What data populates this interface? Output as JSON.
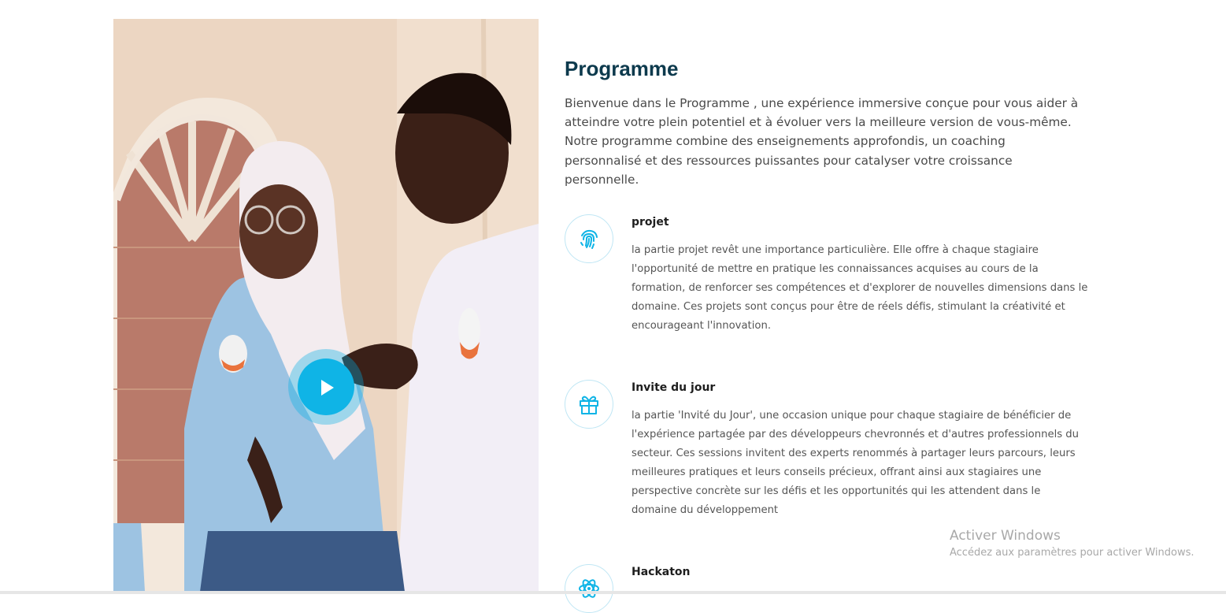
{
  "video": {
    "play_icon": "play-icon",
    "colors": {
      "play": "#0fb4e6"
    }
  },
  "programme": {
    "title": "Programme",
    "intro": "Bienvenue dans le Programme , une expérience immersive conçue pour vous aider à atteindre votre plein potentiel et à évoluer vers la meilleure version de vous-même. Notre programme combine des enseignements approfondis, un coaching personnalisé et des ressources puissantes pour catalyser votre croissance personnelle."
  },
  "features": [
    {
      "icon": "fingerprint-icon",
      "title": "projet",
      "text": "la partie projet revêt une importance particulière. Elle offre à chaque stagiaire l'opportunité de mettre en pratique les connaissances acquises au cours de la formation, de renforcer ses compétences et d'explorer de nouvelles dimensions dans le domaine. Ces projets sont conçus pour être de réels défis, stimulant la créativité et encourageant l'innovation."
    },
    {
      "icon": "gift-icon",
      "title": "Invite du jour",
      "text": "la partie 'Invité du Jour', une occasion unique pour chaque stagiaire de bénéficier de l'expérience partagée par des développeurs chevronnés et d'autres professionnels du secteur. Ces sessions invitent des experts renommés à partager leurs parcours, leurs meilleures pratiques et leurs conseils précieux, offrant ainsi aux stagiaires une perspective concrète sur les défis et les opportunités qui les attendent dans le domaine du développement"
    },
    {
      "icon": "atom-icon",
      "title": "Hackaton",
      "text": ""
    }
  ],
  "watermark": {
    "title": "Activer Windows",
    "subtitle": "Accédez aux paramètres pour activer Windows."
  },
  "theme": {
    "accent": "#0fb4e6",
    "heading": "#0d3a4d",
    "text": "#4a4a4a"
  }
}
